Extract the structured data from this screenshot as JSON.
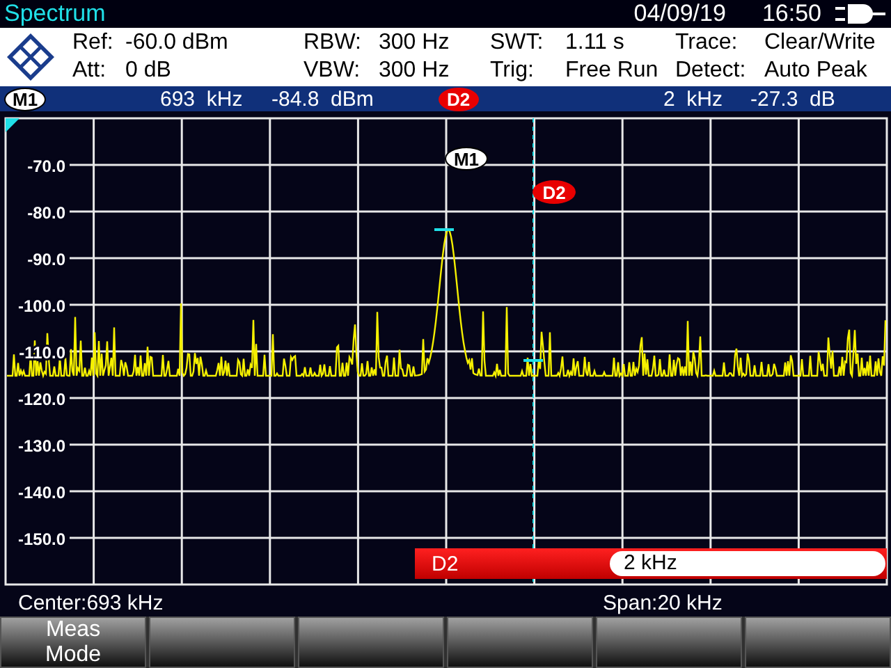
{
  "header": {
    "title": "Spectrum",
    "date": "04/09/19",
    "time": "16:50"
  },
  "settings": [
    {
      "label": "Ref:",
      "value": "-60.0 dBm"
    },
    {
      "label": "RBW:",
      "value": "300 Hz"
    },
    {
      "label": "SWT:",
      "value": "1.11 s"
    },
    {
      "label": "Trace:",
      "value": "Clear/Write"
    },
    {
      "label": "Att:",
      "value": "0 dB"
    },
    {
      "label": "VBW:",
      "value": "300 Hz"
    },
    {
      "label": "Trig:",
      "value": "Free Run"
    },
    {
      "label": "Detect:",
      "value": "Auto Peak"
    }
  ],
  "marker_readout": {
    "marker": {
      "label": "M1",
      "kind": "normal"
    },
    "frequency": "693  kHz",
    "level": "-84.8  dBm",
    "delta": {
      "label": "D2",
      "kind": "delta"
    },
    "delta_frequency": "2  kHz",
    "delta_level": "-27.3  dB"
  },
  "graph": {
    "y_labels": [
      "-70.0",
      "-80.0",
      "-90.0",
      "-100.0",
      "-110.0",
      "-120.0",
      "-130.0",
      "-140.0",
      "-150.0"
    ],
    "markers": [
      {
        "label": "M1",
        "kind": "normal"
      },
      {
        "label": "D2",
        "kind": "delta"
      }
    ]
  },
  "delta_entry": {
    "label": "D2",
    "value": "2 kHz"
  },
  "footer": {
    "center": "Center:693 kHz",
    "span": "Span:20 kHz"
  },
  "softkeys": [
    {
      "kind": "labeled",
      "label": "Meas Mode"
    },
    {
      "kind": "blank"
    },
    {
      "kind": "blank"
    },
    {
      "kind": "blank"
    },
    {
      "kind": "blank"
    },
    {
      "kind": "blank"
    }
  ]
}
